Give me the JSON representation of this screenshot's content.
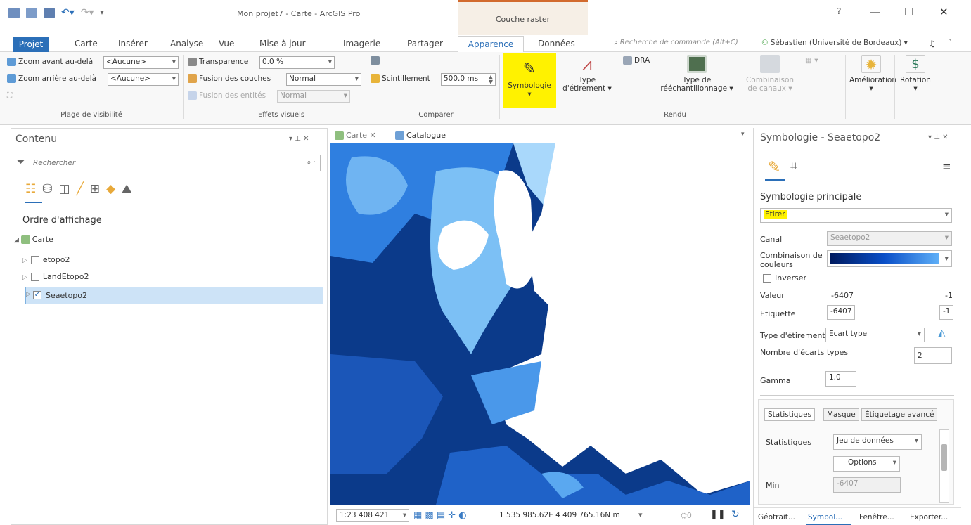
{
  "window": {
    "title": "Mon projet7 - Carte - ArcGIS Pro",
    "context_tab": "Couche raster",
    "help": "?",
    "minimize": "—",
    "maximize": "☐",
    "close": "✕"
  },
  "tabs": [
    "Carte",
    "Insérer",
    "Analyse",
    "Vue",
    "Mise à jour",
    "Imagerie",
    "Partager",
    "Données"
  ],
  "tab_projet": "Projet",
  "tab_active": "Apparence",
  "command_search_placeholder": "Recherche de commande (Alt+C)",
  "user": "Sébastien (Université de Bordeaux) ▾",
  "ribbon": {
    "visibility": {
      "zoom_in_label": "Zoom avant au-delà",
      "zoom_in_value": "<Aucune>",
      "zoom_out_label": "Zoom arrière au-delà",
      "zoom_out_value": "<Aucune>",
      "group": "Plage de visibilité"
    },
    "effects": {
      "transparency_label": "Transparence",
      "transparency_value": "0.0 %",
      "layer_blend_label": "Fusion des couches",
      "layer_blend_value": "Normal",
      "feature_blend_label": "Fusion des entités",
      "feature_blend_value": "Normal",
      "group": "Effets visuels"
    },
    "compare": {
      "flicker_label": "Scintillement",
      "flicker_value": "500.0 ms",
      "group": "Comparer"
    },
    "render": {
      "symbology": "Symbologie",
      "stretch_type_1": "Type",
      "stretch_type_2": "d'étirement ▾",
      "dra": "DRA",
      "resample_1": "Type de",
      "resample_2": "rééchantillonnage ▾",
      "band_combo_1": "Combinaison",
      "band_combo_2": "de canaux ▾",
      "group": "Rendu"
    },
    "enhance": {
      "amelioration": "Amélioration",
      "rotation": "Rotation"
    }
  },
  "contents": {
    "title": "Contenu",
    "pin": "▾ ⊥ ✕",
    "search_placeholder": "Rechercher",
    "draw_order": "Ordre d'affichage",
    "map": "Carte",
    "layers": [
      {
        "name": "etopo2",
        "checked": false
      },
      {
        "name": "LandEtopo2",
        "checked": false
      },
      {
        "name": "Seaetopo2",
        "checked": true
      }
    ]
  },
  "mapview": {
    "tab_map": "Carte",
    "tab_catalog": "Catalogue",
    "scale": "1:23 408 421",
    "coords": "1 535 985.62E 4 409 765.16N m",
    "selected_count": "0"
  },
  "symbology": {
    "title": "Symbologie - Seaetopo2",
    "primary": "Symbologie principale",
    "renderer": "Etirer",
    "band_label": "Canal",
    "band_value": "Seaetopo2",
    "color_scheme_label_1": "Combinaison de",
    "color_scheme_label_2": "couleurs",
    "invert": "Inverser",
    "value_label": "Valeur",
    "value_min": "-6407",
    "value_max": "-1",
    "label_label": "Etiquette",
    "label_min": "-6407",
    "label_max": "-1",
    "stretch_type_label": "Type d'étirement",
    "stretch_type_value": "Ecart type",
    "nstd_label": "Nombre d'écarts types",
    "nstd_value": "2",
    "gamma_label": "Gamma",
    "gamma_value": "1.0",
    "tabs": [
      "Statistiques",
      "Masque",
      "Étiquetage avancé"
    ],
    "stats_label": "Statistiques",
    "stats_value": "Jeu de données",
    "options": "Options",
    "min_label": "Min",
    "min_value": "-6407"
  },
  "bottom_tabs": [
    "Géotrait...",
    "Symbol...",
    "Fenêtre...",
    "Exporter..."
  ],
  "colors": {
    "accent": "#2b6fb8",
    "highlight": "#fff200",
    "context_orange": "#d26a2e"
  }
}
